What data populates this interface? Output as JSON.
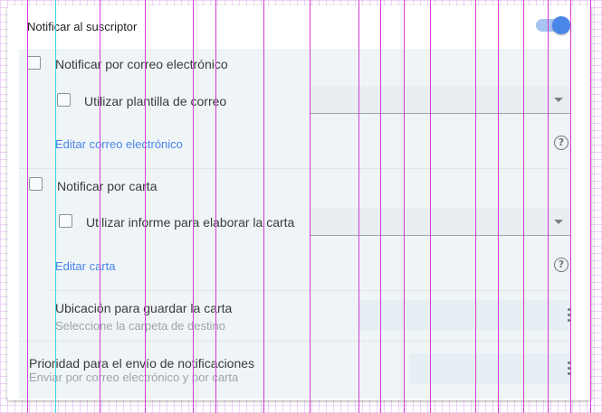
{
  "header": {
    "title": "Notificar al suscriptor",
    "toggle_on": true
  },
  "email": {
    "checkbox_label": "Notificar por correo electrónico",
    "template_label": "Utilizar plantilla de correo",
    "template_select_value": "",
    "edit_link": "Editar correo electrónico"
  },
  "letter": {
    "checkbox_label": "Notificar por carta",
    "report_label": "Utilizar informe para elaborar la carta",
    "report_select_value": "",
    "edit_link": "Editar carta"
  },
  "save_location": {
    "label": "Ubicación para guardar la carta",
    "hint": "Seleccione la carpeta de destino",
    "value": ""
  },
  "priority": {
    "label": "Prioridad para el envío de notificaciones",
    "hint": "Enviar por correo electrónico y por carta",
    "value": ""
  },
  "icons": {
    "help": "?"
  },
  "colors": {
    "accent": "#4a86e8",
    "panel": "#eff5f7"
  }
}
